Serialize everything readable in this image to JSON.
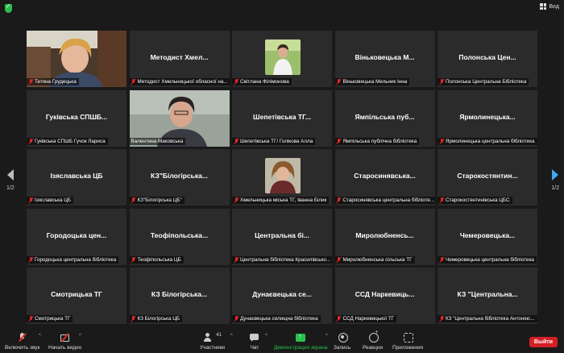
{
  "topbar": {
    "view_label": "Вид"
  },
  "pagination": {
    "left_page": "1/2",
    "right_page": "1/2"
  },
  "tiles": [
    {
      "name": "",
      "label": "Тетяна Грудецька",
      "kind": "video"
    },
    {
      "name": "Методист Хмел...",
      "label": "Методист Хмельницької обласної на...",
      "kind": "text"
    },
    {
      "name": "",
      "label": "Світлана Філімонова",
      "kind": "photo"
    },
    {
      "name": "Віньковецька М...",
      "label": "Віньковецька Мельник Інна",
      "kind": "text"
    },
    {
      "name": "Полонська Цен...",
      "label": "Полонська Центральна Бібліотека",
      "kind": "text"
    },
    {
      "name": "Гуківська СПШБ...",
      "label": "Гуківська СПШБ Гучок Лариса",
      "kind": "text"
    },
    {
      "name": "",
      "label": "Валентина Маковська",
      "kind": "video",
      "active": true
    },
    {
      "name": "Шепетівська ТГ...",
      "label": "Шепетівська ТГ/ Голікова Алла",
      "kind": "text"
    },
    {
      "name": "Ямпільська пуб...",
      "label": "Ямпільська публічна бібліотека",
      "kind": "text"
    },
    {
      "name": "Ярмолинецька...",
      "label": "Ярмолинецька центральна бібліотека",
      "kind": "text"
    },
    {
      "name": "Ізяславська ЦБ",
      "label": "Ізяславська ЦБ",
      "kind": "text"
    },
    {
      "name": "КЗ\"Білогірська...",
      "label": "КЗ\"Білогірська ЦБ\"",
      "kind": "text"
    },
    {
      "name": "",
      "label": "Хмельницька міська ТГ, Іванна Білик",
      "kind": "photo"
    },
    {
      "name": "Старосинявська...",
      "label": "Старосинявська центральна бібліоте...",
      "kind": "text"
    },
    {
      "name": "Старокостянтин...",
      "label": "Старокостянтинівська ЦБС",
      "kind": "text"
    },
    {
      "name": "Городоцька цен...",
      "label": "Городоцька центральна бібліотека",
      "kind": "text"
    },
    {
      "name": "Теофіпольська...",
      "label": "Теофіпольська ЦБ",
      "kind": "text"
    },
    {
      "name": "Центральна бі...",
      "label": "Центральна бібліотека Красилівсько...",
      "kind": "text"
    },
    {
      "name": "Миролюбненсь...",
      "label": "Миролюбненська сільська ТГ",
      "kind": "text"
    },
    {
      "name": "Чемеровецька...",
      "label": "Чемеровецька центральна бібліотека",
      "kind": "text"
    },
    {
      "name": "Смотрицька ТГ",
      "label": "Смотрицька ТГ",
      "kind": "text"
    },
    {
      "name": "КЗ Білогірська...",
      "label": "КЗ Білогірська ЦБ",
      "kind": "text"
    },
    {
      "name": "Дунаєвецька се...",
      "label": "Дунаєвецька селищна бібліотека",
      "kind": "text"
    },
    {
      "name": "ССД Наркевиць...",
      "label": "ССД Наркевицької ТГ",
      "kind": "text"
    },
    {
      "name": "КЗ \"Центральна...",
      "label": "КЗ \"Центральна бібліотека Антонінс...",
      "kind": "text"
    }
  ],
  "toolbar": {
    "unmute_label": "Включить звук",
    "start_video_label": "Начать видео",
    "participants_label": "Участники",
    "participants_count": "41",
    "chat_label": "Чат",
    "share_label": "Демонстрация экрана",
    "record_label": "Запись",
    "reactions_label": "Реакции",
    "apps_label": "Приложения",
    "leave_label": "Выйти"
  },
  "colors": {
    "active_speaker": "#c8e63c",
    "leave": "#d41f26",
    "share": "#27c24c",
    "mic_off": "#e02828"
  }
}
